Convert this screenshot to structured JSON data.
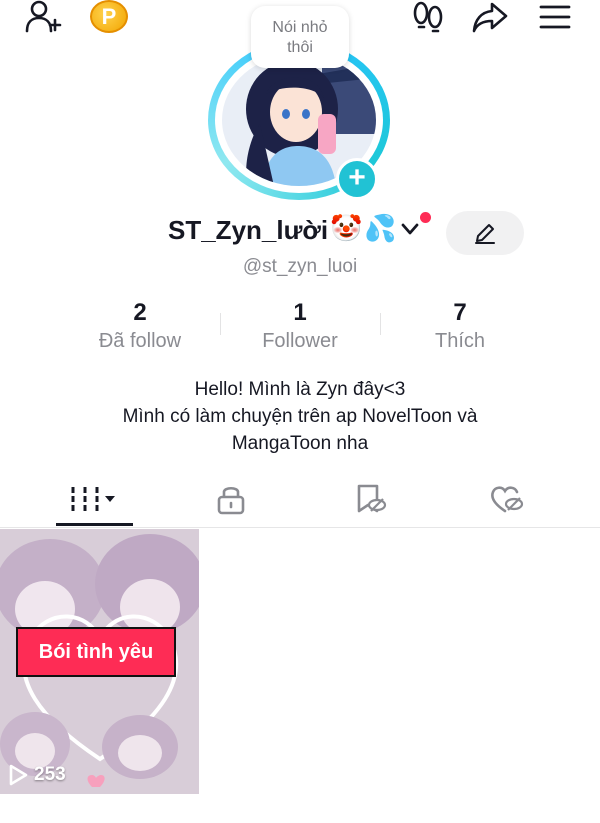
{
  "note": {
    "text_line1": "Nói nhỏ",
    "text_line2": "thôi"
  },
  "profile": {
    "username": "ST_Zyn_lười",
    "handle": "@st_zyn_luoi",
    "coin_label": "P"
  },
  "stats": [
    {
      "value": "2",
      "label": "Đã follow"
    },
    {
      "value": "1",
      "label": "Follower"
    },
    {
      "value": "7",
      "label": "Thích"
    }
  ],
  "bio": {
    "line1": "Hello! Mình là Zyn đây<3",
    "line2": "Mình có làm chuyện trên ap NovelToon và",
    "line3": "MangaToon nha"
  },
  "videos": [
    {
      "caption": "Bói tình yêu",
      "views": "253"
    }
  ],
  "colors": {
    "accent": "#fe2c55",
    "ring": "#28c3ff",
    "add_button": "#21c2d4"
  }
}
